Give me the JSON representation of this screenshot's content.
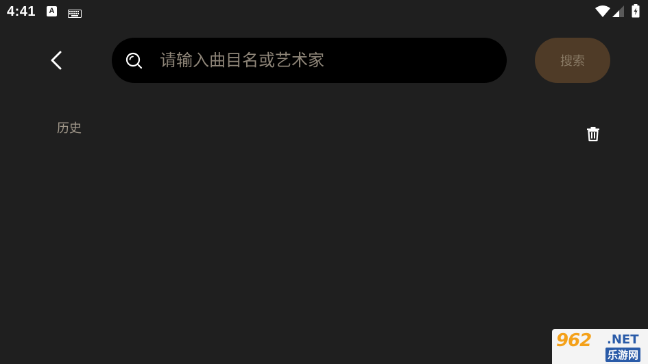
{
  "status_bar": {
    "time": "4:41",
    "notification_icon": "A",
    "icons": [
      "a-notification-icon",
      "keyboard-icon",
      "wifi-icon",
      "cell-signal-icon",
      "battery-charging-icon"
    ]
  },
  "header": {
    "back_icon": "chevron-left-icon",
    "search": {
      "icon": "search-icon",
      "value": "",
      "placeholder": "请输入曲目名或艺术家"
    },
    "search_button_label": "搜索"
  },
  "history": {
    "title": "历史",
    "clear_icon": "trash-icon",
    "items": []
  },
  "watermark": {
    "brand": "962",
    "domain": ".NET",
    "subtitle": "乐游网"
  },
  "colors": {
    "background": "#1f1f1f",
    "search_box": "#000000",
    "search_button_bg": "#4f3b27",
    "search_button_text": "#8a7b66",
    "placeholder_text": "#8e8578",
    "history_title": "#a39a8c"
  }
}
